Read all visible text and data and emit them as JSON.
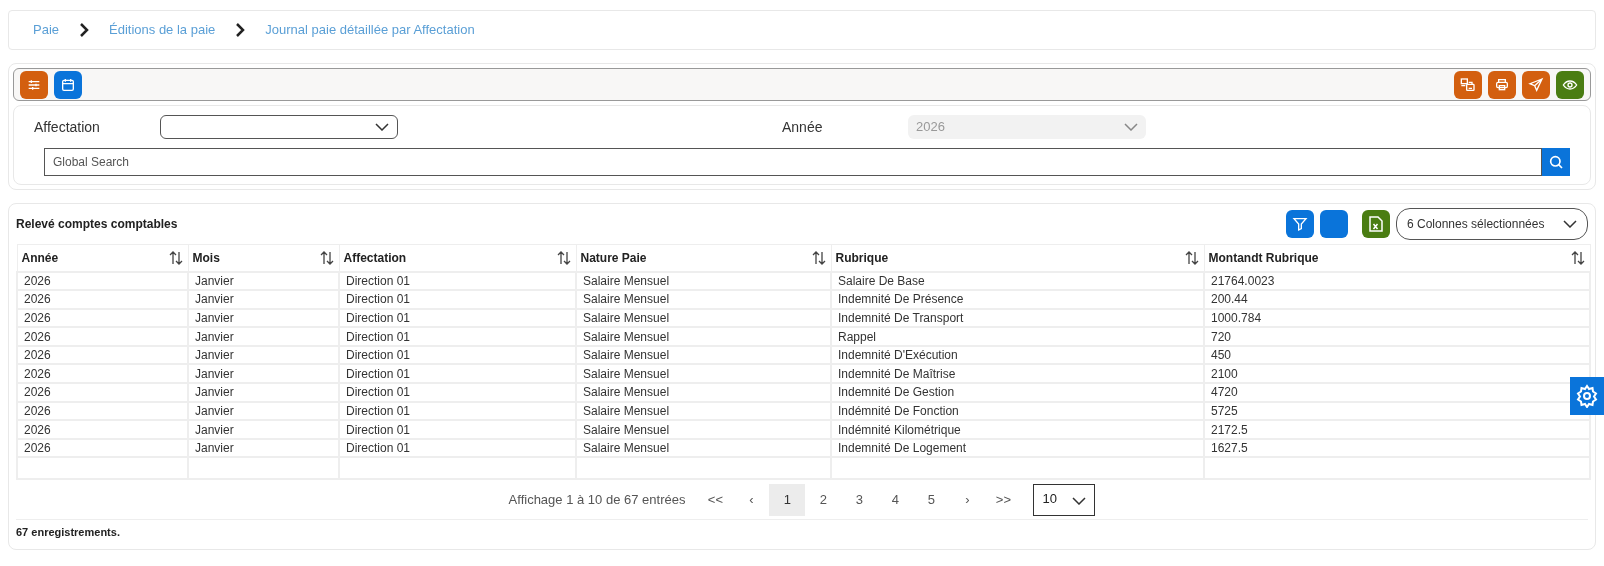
{
  "breadcrumb": [
    {
      "label": "Paie"
    },
    {
      "label": "Éditions de la paie"
    },
    {
      "label": "Journal paie détaillée par Affectation"
    }
  ],
  "toolbar": {
    "left_buttons": [
      {
        "kind": "sliders",
        "color": "#d35f0f"
      },
      {
        "kind": "calendar",
        "color": "#0a74da"
      }
    ],
    "right_buttons": [
      {
        "kind": "printers",
        "color": "#d35f0f"
      },
      {
        "kind": "print",
        "color": "#d35f0f"
      },
      {
        "kind": "send",
        "color": "#d35f0f"
      },
      {
        "kind": "eye",
        "color": "#4a7d12"
      }
    ]
  },
  "filters": {
    "affectation": {
      "label": "Affectation",
      "disabled": false
    },
    "annee": {
      "label": "Année",
      "value": "2026",
      "disabled": true
    },
    "search": {
      "placeholder": "Global Search"
    }
  },
  "table": {
    "title": "Relevé comptes comptables",
    "columns_selector": "6 Colonnes sélectionnées",
    "columns": [
      "Année",
      "Mois",
      "Affectation",
      "Nature Paie",
      "Rubrique",
      "Montandt Rubrique"
    ],
    "rows": [
      [
        "2026",
        "Janvier",
        "Direction 01",
        "Salaire Mensuel",
        "Salaire De Base",
        "21764.0023"
      ],
      [
        "2026",
        "Janvier",
        "Direction 01",
        "Salaire Mensuel",
        "Indemnité De Présence",
        "200.44"
      ],
      [
        "2026",
        "Janvier",
        "Direction 01",
        "Salaire Mensuel",
        "Indemnité De Transport",
        "1000.784"
      ],
      [
        "2026",
        "Janvier",
        "Direction 01",
        "Salaire Mensuel",
        "Rappel",
        "720"
      ],
      [
        "2026",
        "Janvier",
        "Direction 01",
        "Salaire Mensuel",
        "Indemnité D'Exécution",
        "450"
      ],
      [
        "2026",
        "Janvier",
        "Direction 01",
        "Salaire Mensuel",
        "Indemnité De Maîtrise",
        "2100"
      ],
      [
        "2026",
        "Janvier",
        "Direction 01",
        "Salaire Mensuel",
        "Indemnité De Gestion",
        "4720"
      ],
      [
        "2026",
        "Janvier",
        "Direction 01",
        "Salaire Mensuel",
        "Indémnité De Fonction",
        "5725"
      ],
      [
        "2026",
        "Janvier",
        "Direction 01",
        "Salaire Mensuel",
        "Indémnité Kilométrique",
        "2172.5"
      ],
      [
        "2026",
        "Janvier",
        "Direction 01",
        "Salaire Mensuel",
        "Indemnité De Logement",
        "1627.5"
      ]
    ],
    "pagination": {
      "summary": "Affichage 1 à 10 de 67 entrées",
      "first": "<<",
      "prev": "‹",
      "pages": [
        {
          "label": "1",
          "selected": true
        },
        {
          "label": "2",
          "selected": false
        },
        {
          "label": "3",
          "selected": false
        },
        {
          "label": "4",
          "selected": false
        },
        {
          "label": "5",
          "selected": false
        }
      ],
      "next": "›",
      "last": ">>",
      "page_size": "10"
    },
    "footer": "67 enregistrements."
  }
}
